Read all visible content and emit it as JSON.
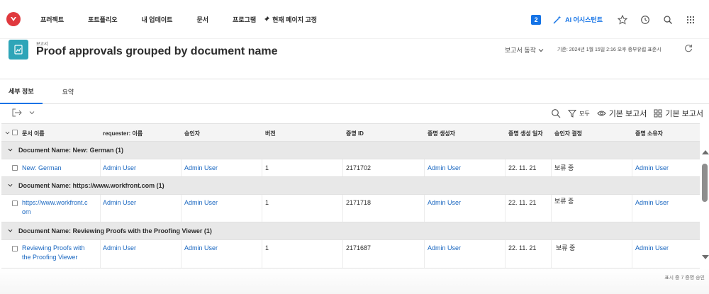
{
  "nav": {
    "items": [
      "프러젝트",
      "포트폴리오",
      "내 업데이트",
      "문서",
      "프로그램"
    ],
    "pin_label": "현재 페이지 고정",
    "badge_count": "2",
    "ai_label": "AI 어시스턴트"
  },
  "header": {
    "eyebrow": "보고서",
    "title": "Proof approvals grouped by document name",
    "actions_label": "보고서 동작",
    "updated": "기준: 2024년 1월 15일 2:16 오후 중부유럽 표준시"
  },
  "tabs": [
    {
      "label": "세부 정보",
      "active": true
    },
    {
      "label": "요약",
      "active": false
    }
  ],
  "toolbar": {
    "filter_label": "모두",
    "view_label": "기본 보고서",
    "group_label": "기본 보고서"
  },
  "table": {
    "columns": [
      "문서 이름",
      "requester: 이름",
      "승인자",
      "버전",
      "증명 ID",
      "증명 생성자",
      "증명 생성 일자",
      "승인자 결정",
      "증명 소유자"
    ],
    "groups": [
      {
        "label": "Document Name: New: German (1)",
        "rows": [
          {
            "doc": [
              "New: German"
            ],
            "requester": "Admin User",
            "approver": "Admin User",
            "version": "1",
            "proof_id": "2171702",
            "creator": "Admin User",
            "date": "22. 11. 21",
            "decision": "보류 중",
            "owner": "Admin User"
          }
        ]
      },
      {
        "label": "Document Name: https://www.workfront.com (1)",
        "rows": [
          {
            "doc": [
              "https://www.workfront.c",
              "om"
            ],
            "requester": "Admin User",
            "approver": "Admin User",
            "version": "1",
            "proof_id": "2171718",
            "creator": "Admin User",
            "date": "22. 11. 21",
            "decision": "보류 중",
            "owner": "Admin User"
          }
        ]
      },
      {
        "label": "Document Name: Reviewing Proofs with the Proofing Viewer (1)",
        "rows": [
          {
            "doc": [
              "Reviewing Proofs with",
              "the Proofing Viewer"
            ],
            "requester": "Admin User",
            "approver": "Admin User",
            "version": "1",
            "proof_id": "2171687",
            "creator": "Admin User",
            "date": "22. 11. 21",
            "decision": "보류 중",
            "owner": "Admin User"
          }
        ]
      }
    ]
  },
  "footer": {
    "status": "표시 중 7 증명 승인"
  }
}
